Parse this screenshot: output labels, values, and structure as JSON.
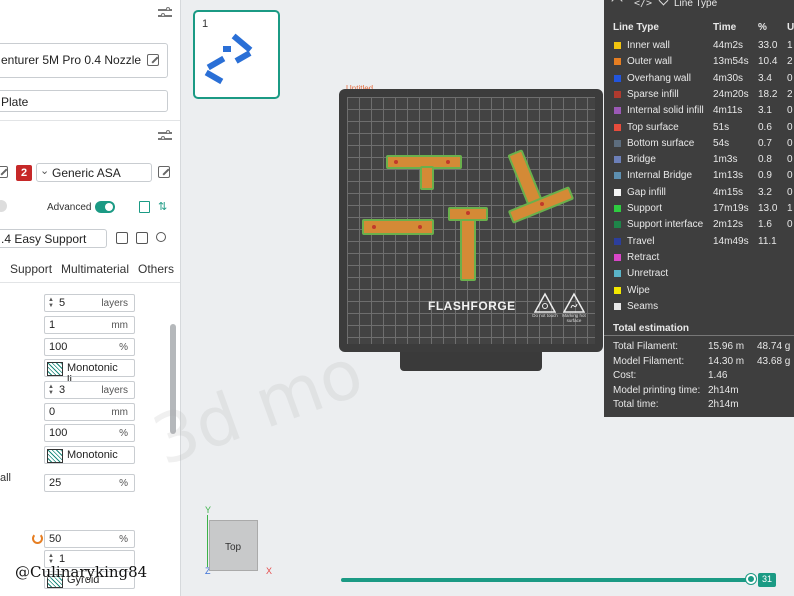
{
  "left_panel": {
    "printer_name": "enturer 5M Pro 0.4 Nozzle",
    "plate_type": "Plate",
    "filament": {
      "index": "2",
      "index_color": "#c62828",
      "name": "Generic ASA"
    },
    "advanced_label": "Advanced",
    "advanced_on": true,
    "process_preset": ".4 Easy Support",
    "tabs": [
      "Support",
      "Multimaterial",
      "Others"
    ],
    "wall_label_fragment": "all",
    "params": [
      {
        "value": "5",
        "unit": "layers",
        "spinner": true
      },
      {
        "value": "1",
        "unit": "mm"
      },
      {
        "value": "100",
        "unit": "%"
      },
      {
        "value": "Monotonic li...",
        "pattern": true
      },
      {
        "value": "3",
        "unit": "layers",
        "spinner": true
      },
      {
        "value": "0",
        "unit": "mm"
      },
      {
        "value": "100",
        "unit": "%"
      },
      {
        "value": "Monotonic",
        "pattern": true
      },
      {
        "value": "25",
        "unit": "%"
      },
      {
        "value": "50",
        "unit": "%",
        "reset": true
      },
      {
        "value": "1",
        "spinner": true
      },
      {
        "value": "Gyroid",
        "pattern": true
      }
    ]
  },
  "thumbnail": {
    "plate_number": "1"
  },
  "viewport": {
    "plate_label": "Untitled",
    "brand": "FLASHFORGE",
    "warning_1": "Do not touch",
    "warning_2": "Marking hot surface",
    "watermark": "3d mo",
    "view_cube_label": "Top",
    "axes": {
      "x": "X",
      "y": "Y",
      "z": "Z"
    },
    "layer_count": "31"
  },
  "legend": {
    "header_title": "Line Type",
    "columns": [
      "Line Type",
      "Time",
      "%",
      "U"
    ],
    "rows": [
      {
        "name": "Inner wall",
        "time": "44m2s",
        "pct": "33.0",
        "extra": "1",
        "color": "#f1c40f"
      },
      {
        "name": "Outer wall",
        "time": "13m54s",
        "pct": "10.4",
        "extra": "2",
        "color": "#e67e22"
      },
      {
        "name": "Overhang wall",
        "time": "4m30s",
        "pct": "3.4",
        "extra": "0",
        "color": "#2255dd"
      },
      {
        "name": "Sparse infill",
        "time": "24m20s",
        "pct": "18.2",
        "extra": "2",
        "color": "#b03a2e"
      },
      {
        "name": "Internal solid infill",
        "time": "4m11s",
        "pct": "3.1",
        "extra": "0",
        "color": "#9b59b6"
      },
      {
        "name": "Top surface",
        "time": "51s",
        "pct": "0.6",
        "extra": "0",
        "color": "#e74c3c"
      },
      {
        "name": "Bottom surface",
        "time": "54s",
        "pct": "0.7",
        "extra": "0",
        "color": "#5d6d7e"
      },
      {
        "name": "Bridge",
        "time": "1m3s",
        "pct": "0.8",
        "extra": "0",
        "color": "#6c7fb8"
      },
      {
        "name": "Internal Bridge",
        "time": "1m13s",
        "pct": "0.9",
        "extra": "0",
        "color": "#5d8fb0"
      },
      {
        "name": "Gap infill",
        "time": "4m15s",
        "pct": "3.2",
        "extra": "0",
        "color": "#f5f5f5"
      },
      {
        "name": "Support",
        "time": "17m19s",
        "pct": "13.0",
        "extra": "1",
        "color": "#2ecc40"
      },
      {
        "name": "Support interface",
        "time": "2m12s",
        "pct": "1.6",
        "extra": "0",
        "color": "#1e8449"
      },
      {
        "name": "Travel",
        "time": "14m49s",
        "pct": "11.1",
        "extra": "",
        "color": "#2c3e9c"
      },
      {
        "name": "Retract",
        "time": "",
        "pct": "",
        "extra": "",
        "color": "#d946c8"
      },
      {
        "name": "Unretract",
        "time": "",
        "pct": "",
        "extra": "",
        "color": "#5ab4c8"
      },
      {
        "name": "Wipe",
        "time": "",
        "pct": "",
        "extra": "",
        "color": "#f4e800"
      },
      {
        "name": "Seams",
        "time": "",
        "pct": "",
        "extra": "",
        "color": "#e8e8e8"
      }
    ],
    "estimation_title": "Total estimation",
    "estimation": [
      {
        "label": "Total Filament:",
        "v1": "15.96 m",
        "v2": "48.74 g"
      },
      {
        "label": "Model Filament:",
        "v1": "14.30 m",
        "v2": "43.68 g"
      },
      {
        "label": "Cost:",
        "v1": "1.46",
        "v2": ""
      },
      {
        "label": "Model printing time:",
        "v1": "2h14m",
        "v2": ""
      },
      {
        "label": "Total time:",
        "v1": "2h14m",
        "v2": ""
      }
    ]
  },
  "handle": "@Culinaryking84"
}
